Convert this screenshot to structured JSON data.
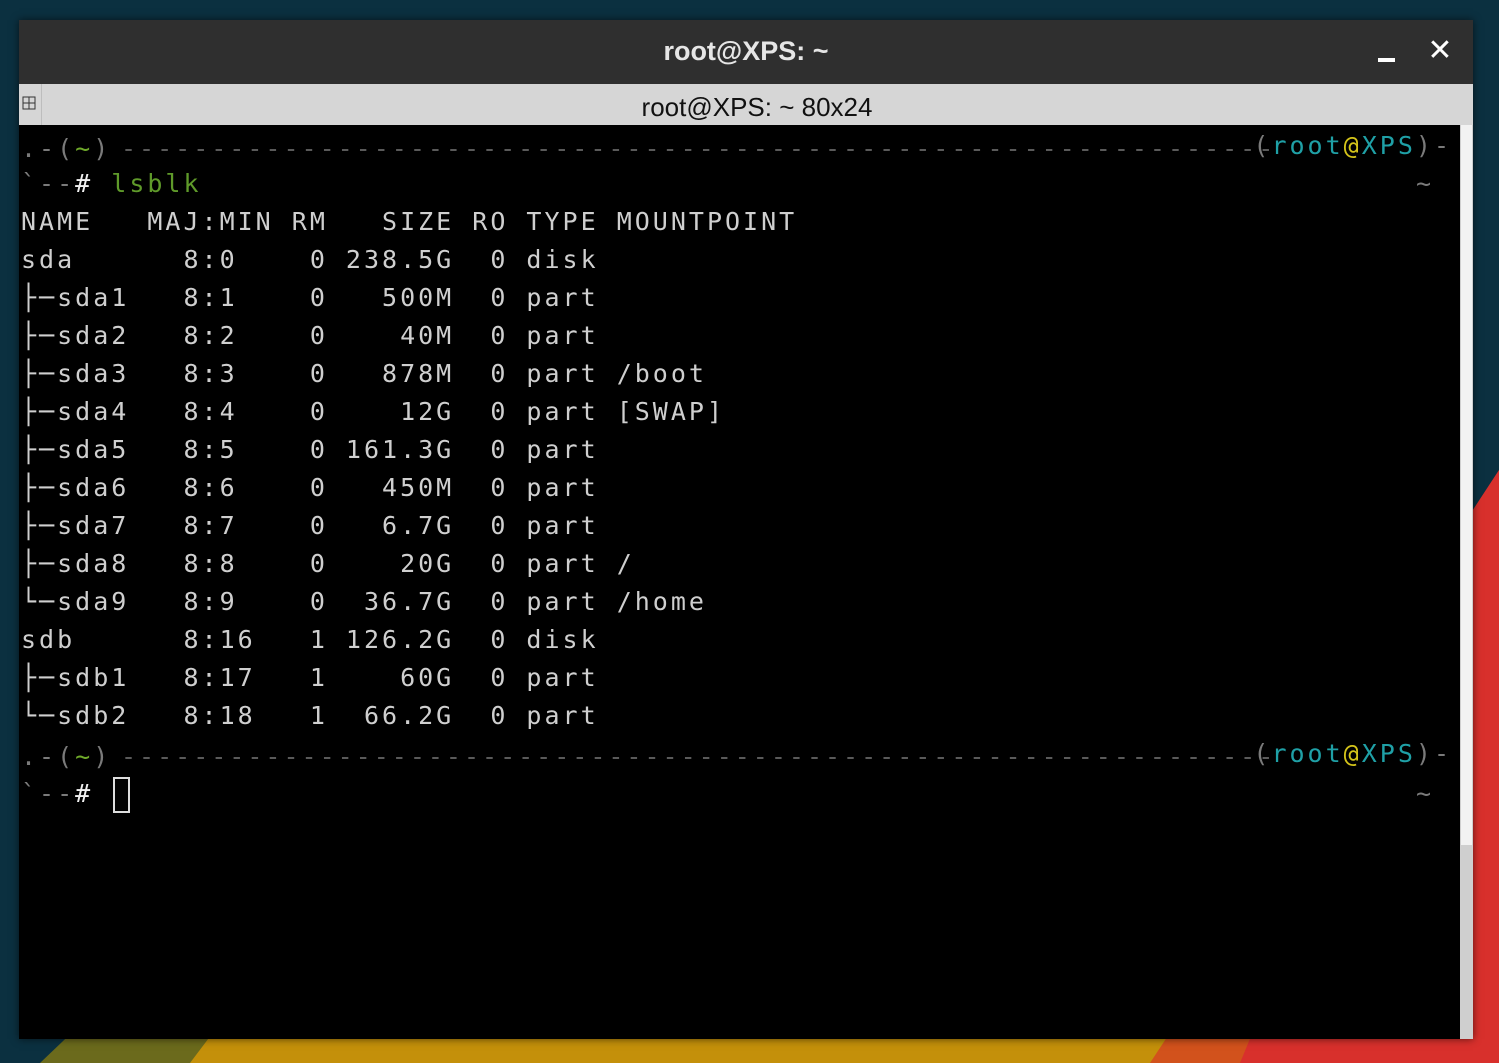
{
  "window": {
    "title": "root@XPS: ~"
  },
  "tab": {
    "title": "root@XPS: ~ 80x24"
  },
  "prompt": {
    "open": ".-(",
    "dir": "~",
    "close": ")",
    "paren_open": "(",
    "user": "root",
    "at": "@",
    "host": "XPS",
    "paren_close": ")-",
    "lead": "`--",
    "hash": "#",
    "tilde_right": "~"
  },
  "command": "lsblk",
  "output": {
    "header": "NAME   MAJ:MIN RM   SIZE RO TYPE MOUNTPOINT",
    "rows": [
      "sda      8:0    0 238.5G  0 disk ",
      "├─sda1   8:1    0   500M  0 part ",
      "├─sda2   8:2    0    40M  0 part ",
      "├─sda3   8:3    0   878M  0 part /boot",
      "├─sda4   8:4    0    12G  0 part [SWAP]",
      "├─sda5   8:5    0 161.3G  0 part ",
      "├─sda6   8:6    0   450M  0 part ",
      "├─sda7   8:7    0   6.7G  0 part ",
      "├─sda8   8:8    0    20G  0 part /",
      "└─sda9   8:9    0  36.7G  0 part /home",
      "sdb      8:16   1 126.2G  0 disk ",
      "├─sdb1   8:17   1    60G  0 part ",
      "└─sdb2   8:18   1  66.2G  0 part "
    ]
  },
  "colors": {
    "terminal_bg": "#000000",
    "prompt_green": "#6faa2a",
    "host_cyan": "#1fa0a6",
    "at_yellow": "#d4c41a"
  }
}
